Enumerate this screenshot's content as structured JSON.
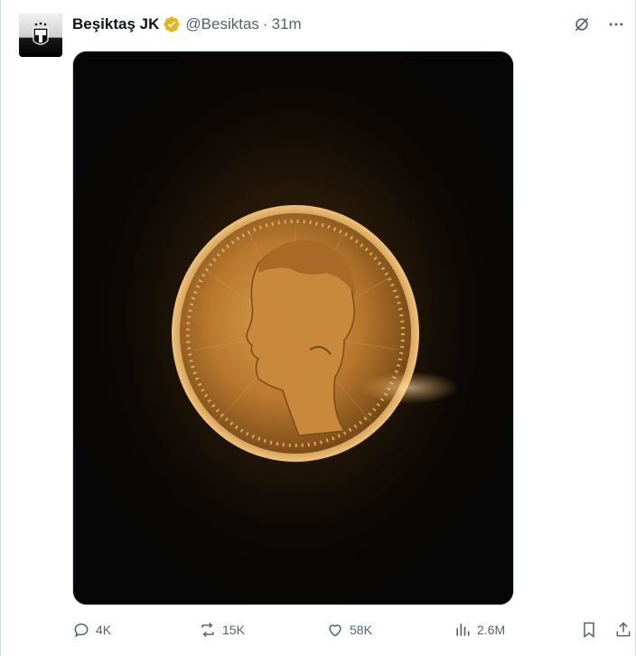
{
  "tweet": {
    "author": {
      "display_name": "Beşiktaş JK",
      "handle": "@Besiktas",
      "verified": true,
      "avatar_icon": "besiktas-crest-icon"
    },
    "separator": "·",
    "time": "31m",
    "media": {
      "description_icon": "gold-coin-portrait-image"
    },
    "metrics": {
      "replies": "4K",
      "reposts": "15K",
      "likes": "58K",
      "views": "2.6M"
    }
  },
  "colors": {
    "text_primary": "#0f1419",
    "text_secondary": "#536471",
    "verified_gold": "#e2b719",
    "border": "#cfd9de"
  }
}
